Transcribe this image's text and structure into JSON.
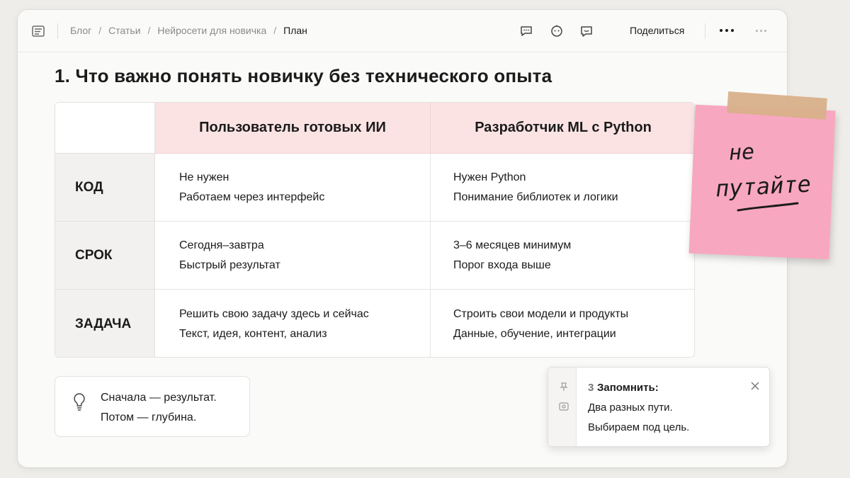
{
  "topbar": {
    "breadcrumb": [
      "Блог",
      "Статьи",
      "Нейросети для новичка",
      "План"
    ],
    "share_label": "Поделиться"
  },
  "page": {
    "title": "1.  Что важно понять новичку без технического опыта"
  },
  "table": {
    "headers": [
      "Пользователь готовых ИИ",
      "Разработчик ML с Python"
    ],
    "rows": [
      {
        "label": "КОД",
        "c1": [
          "Не нужен",
          "Работаем через интерфейс"
        ],
        "c2": [
          "Нужен Python",
          "Понимание библиотек и логики"
        ]
      },
      {
        "label": "СРОК",
        "c1": [
          "Сегодня–завтра",
          "Быстрый результат"
        ],
        "c2": [
          "3–6 месяцев минимум",
          "Порог входа выше"
        ]
      },
      {
        "label": "ЗАДАЧА",
        "c1": [
          "Решить свою задачу здесь и сейчас",
          "Текст, идея, контент, анализ"
        ],
        "c2": [
          "Строить свои модели и продукты",
          "Данные, обучение, интеграции"
        ]
      }
    ]
  },
  "tip": {
    "line1": "Сначала — результат.",
    "line2": "Потом — глубина."
  },
  "toast": {
    "count": "3",
    "title": "Запомнить:",
    "line1": "Два разных пути.",
    "line2": "Выбираем под цель."
  },
  "sticky": {
    "line1": "не",
    "line2": "путайте",
    "color": "#f8a7c1",
    "tape_color": "#d8b08a"
  },
  "colors": {
    "header_bg": "#fbe3e3",
    "row_header_bg": "#f2f1ef",
    "page_bg": "#eeedea"
  }
}
